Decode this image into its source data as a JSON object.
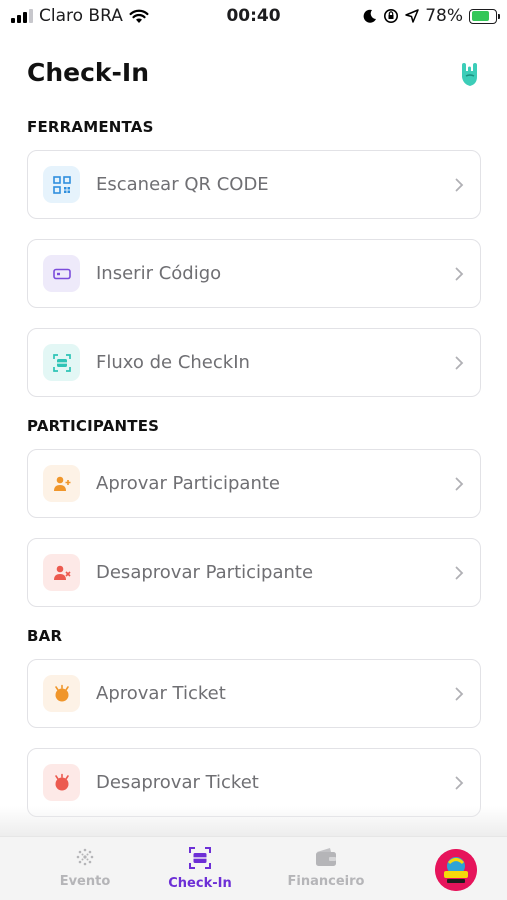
{
  "status_bar": {
    "carrier": "Claro BRA",
    "time": "00:40",
    "battery": "78%",
    "battery_level": 0.78
  },
  "header": {
    "title": "Check-In",
    "icon": "rock-hand-icon"
  },
  "sections": [
    {
      "title": "FERRAMENTAS",
      "items": [
        {
          "label": "Escanear QR CODE",
          "icon": "qr-scan-icon"
        },
        {
          "label": "Inserir Código",
          "icon": "code-card-icon"
        },
        {
          "label": "Fluxo de CheckIn",
          "icon": "scan-frame-icon"
        }
      ]
    },
    {
      "title": "PARTICIPANTES",
      "items": [
        {
          "label": "Aprovar Participante",
          "icon": "user-add-icon"
        },
        {
          "label": "Desaprovar Participante",
          "icon": "user-remove-icon"
        }
      ]
    },
    {
      "title": "BAR",
      "items": [
        {
          "label": "Aprovar Ticket",
          "icon": "ticket-approve-icon"
        },
        {
          "label": "Desaprovar Ticket",
          "icon": "ticket-reject-icon"
        }
      ]
    }
  ],
  "tabs": [
    {
      "label": "Evento",
      "icon": "globe-icon",
      "active": false
    },
    {
      "label": "Check-In",
      "icon": "scan-frame-icon",
      "active": true
    },
    {
      "label": "Financeiro",
      "icon": "wallet-icon",
      "active": false
    }
  ],
  "colors": {
    "accent": "#6d2fd6",
    "teal": "#2ec4b6",
    "blue": "#2f8fde",
    "purple": "#7b4ddb",
    "orange": "#f0962b",
    "red": "#ec5a4f"
  }
}
